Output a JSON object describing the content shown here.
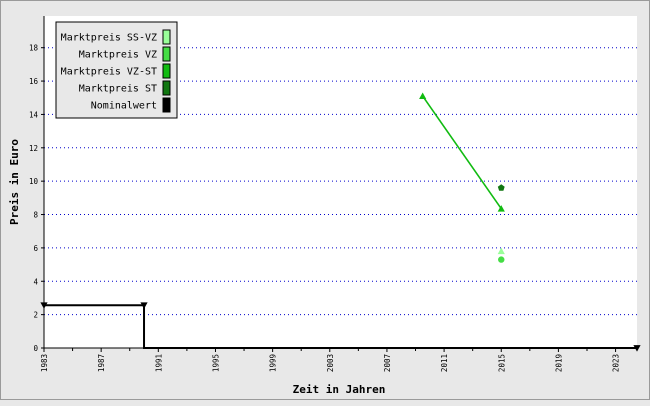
{
  "chart_data": {
    "type": "line",
    "xlabel": "Zeit in Jahren",
    "ylabel": "Preis in Euro",
    "xlim": [
      1983,
      2024.5
    ],
    "ylim": [
      0,
      19.9
    ],
    "x_ticks": [
      1983,
      1987,
      1991,
      1995,
      1999,
      2003,
      2007,
      2011,
      2015,
      2019,
      2023
    ],
    "y_ticks": [
      0,
      2,
      4,
      6,
      8,
      10,
      12,
      14,
      16,
      18
    ],
    "grid": "horizontal dotted",
    "legend_position": "top-left",
    "series": [
      {
        "name": "Marktpreis SS-VZ",
        "color": "#99ff99",
        "marker": "triangle",
        "points": [
          [
            2015,
            5.8
          ]
        ]
      },
      {
        "name": "Marktpreis VZ",
        "color": "#44dd44",
        "marker": "circle",
        "points": [
          [
            2015,
            5.3
          ]
        ]
      },
      {
        "name": "Marktpreis VZ-ST",
        "color": "#11bb11",
        "marker": "triangle",
        "line": true,
        "points": [
          [
            2009.5,
            15.1
          ],
          [
            2015,
            8.35
          ]
        ]
      },
      {
        "name": "Marktpreis ST",
        "color": "#117711",
        "marker": "pentagon",
        "points": [
          [
            2015,
            9.6
          ]
        ]
      },
      {
        "name": "Nominalwert",
        "color": "#000000",
        "marker": "triangle-down",
        "line": "step",
        "points": [
          [
            1983,
            2.56
          ],
          [
            1990,
            2.56
          ],
          [
            1990,
            0
          ],
          [
            2024.5,
            0
          ]
        ]
      }
    ]
  }
}
